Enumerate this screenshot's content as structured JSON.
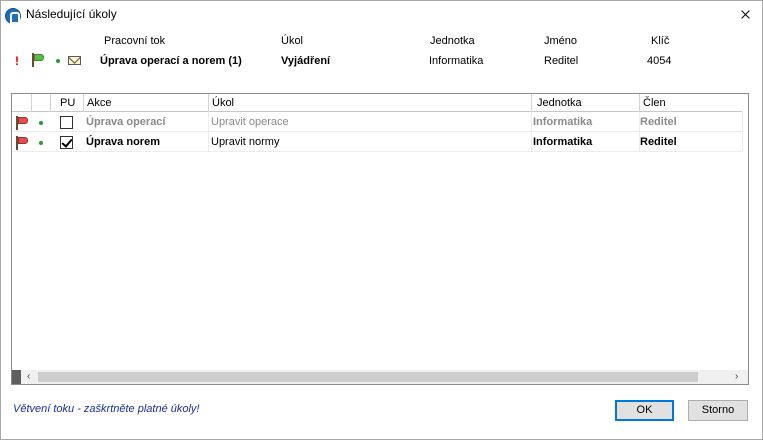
{
  "window": {
    "title": "Následující úkoly"
  },
  "header": {
    "labels": {
      "workflow": "Pracovní tok",
      "task": "Úkol",
      "unit": "Jednotka",
      "name": "Jméno",
      "key": "Klíč"
    },
    "values": {
      "workflow": "Úprava operací a norem (1)",
      "task": "Vyjádření",
      "unit": "Informatika",
      "name": "Reditel",
      "key": "4054"
    },
    "icons": [
      "exclamation-icon",
      "green-flag-icon",
      "dot-icon",
      "mail-icon"
    ]
  },
  "grid": {
    "columns": [
      "",
      "",
      "PU",
      "Akce",
      "Úkol",
      "Jednotka",
      "Člen"
    ],
    "rows": [
      {
        "checked": false,
        "action": "Úprava operací",
        "task": "Upravit operace",
        "unit": "Informatika",
        "member": "Reditel",
        "style": "disabled"
      },
      {
        "checked": true,
        "action": "Úprava norem",
        "task": "Upravit normy",
        "unit": "Informatika",
        "member": "Reditel",
        "style": "normal"
      }
    ]
  },
  "footer": {
    "message": "Větvení toku - zaškrtněte platné úkoly!",
    "ok_label": "OK",
    "cancel_label": "Storno"
  },
  "colors": {
    "accent": "#0078d7",
    "footer_text": "#1a2f9e",
    "disabled_text": "#8a8a8a"
  }
}
